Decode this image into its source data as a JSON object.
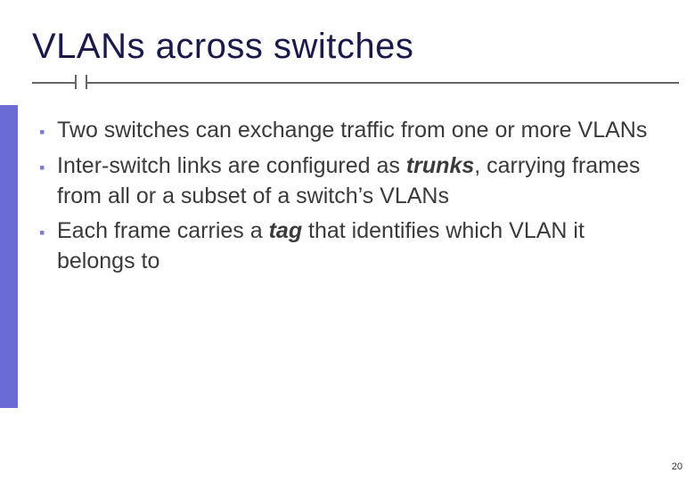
{
  "title": "VLANs across switches",
  "bullets": [
    {
      "pre": "Two switches can exchange traffic from one or more VLANs",
      "em": "",
      "post": ""
    },
    {
      "pre": "Inter-switch links are configured as ",
      "em": "trunks",
      "post": ", carrying frames from all or a subset of a switch’s VLANs"
    },
    {
      "pre": "Each frame carries a ",
      "em": "tag",
      "post": " that identifies which VLAN it belongs to"
    }
  ],
  "page_number": "20"
}
